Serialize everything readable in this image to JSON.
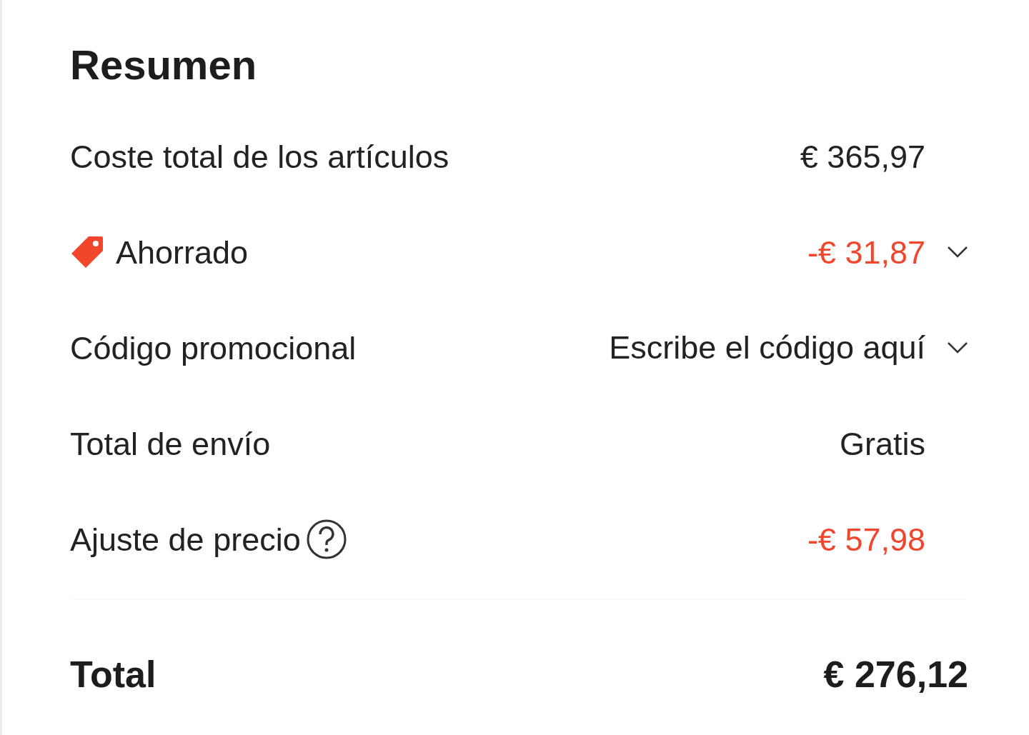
{
  "title": "Resumen",
  "rows": [
    {
      "kind": "plain",
      "label": "Coste total de los artículos",
      "value": "€ 365,97",
      "highlight": false
    },
    {
      "kind": "saving",
      "label": "Ahorrado",
      "value": "-€ 31,87",
      "highlight": true,
      "expanded": false
    },
    {
      "kind": "promo",
      "label": "Código promocional",
      "placeholder": "Escribe el código aquí",
      "expanded": false
    },
    {
      "kind": "plain",
      "label": "Total de envío",
      "value": "Gratis",
      "highlight": false
    },
    {
      "kind": "help",
      "label": "Ajuste de precio",
      "value": "-€ 57,98",
      "highlight": true
    }
  ],
  "total": {
    "label": "Total",
    "value": "€ 276,12"
  }
}
